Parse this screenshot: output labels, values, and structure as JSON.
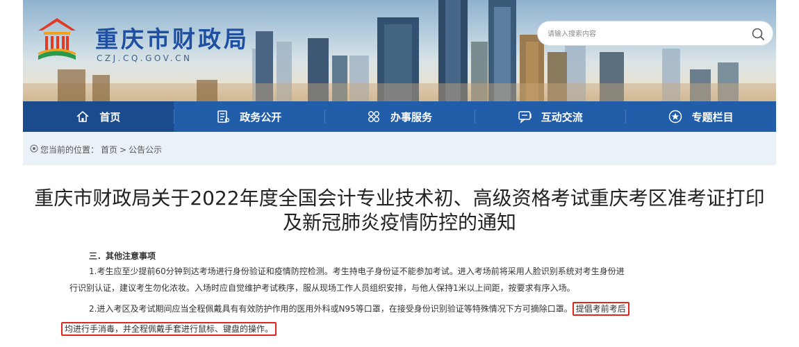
{
  "header": {
    "site_title": "重庆市财政局",
    "site_domain": "CZJ.CQ.GOV.CN",
    "search": {
      "placeholder": "请输入搜索内容"
    }
  },
  "nav": {
    "items": [
      {
        "label": "首页",
        "icon": "home-icon"
      },
      {
        "label": "政务公开",
        "icon": "document-list-icon"
      },
      {
        "label": "办事服务",
        "icon": "service-grid-icon"
      },
      {
        "label": "互动交流",
        "icon": "chat-icon"
      },
      {
        "label": "专题栏目",
        "icon": "star-circle-icon"
      }
    ]
  },
  "breadcrumb": {
    "prefix": "您当前的位置：",
    "home": "首页",
    "separator": ">",
    "current": "公告公示"
  },
  "article": {
    "title_line1": "重庆市财政局关于2022年度全国会计专业技术初、高级资格考试重庆考区准考证打印",
    "title_line2": "及新冠肺炎疫情防控的通知",
    "section_heading": "三．其他注意事项",
    "p1_line1": "1.考生应至少提前60分钟到达考场进行身份验证和疫情防控检测。考生持电子身份证不能参加考试。进入考场前将采用人脸识别系统对考生身份进",
    "p1_line2": "行识别认证，建议考生勿化浓妆。入场时应自觉维护考试秩序，服从现场工作人员组织安排，与他人保持1米以上间距，按要求有序入场。",
    "p2_line1": "2.进入考区及考试期间应当全程佩戴具有有效防护作用的医用外科或N95等口罩，在接受身份识别验证等特殊情况下方可摘除口罩。",
    "p2_highlight1": "提倡考前考后",
    "p2_highlight2": "均进行手消毒，并全程佩戴手套进行鼠标、键盘的操作。"
  },
  "colors": {
    "nav_bg": "#215da8",
    "nav_active": "#1a4b8c",
    "title_blue": "#1f4fa0",
    "crumb_bg": "#eaf1f8",
    "highlight_red": "#e0261b"
  }
}
